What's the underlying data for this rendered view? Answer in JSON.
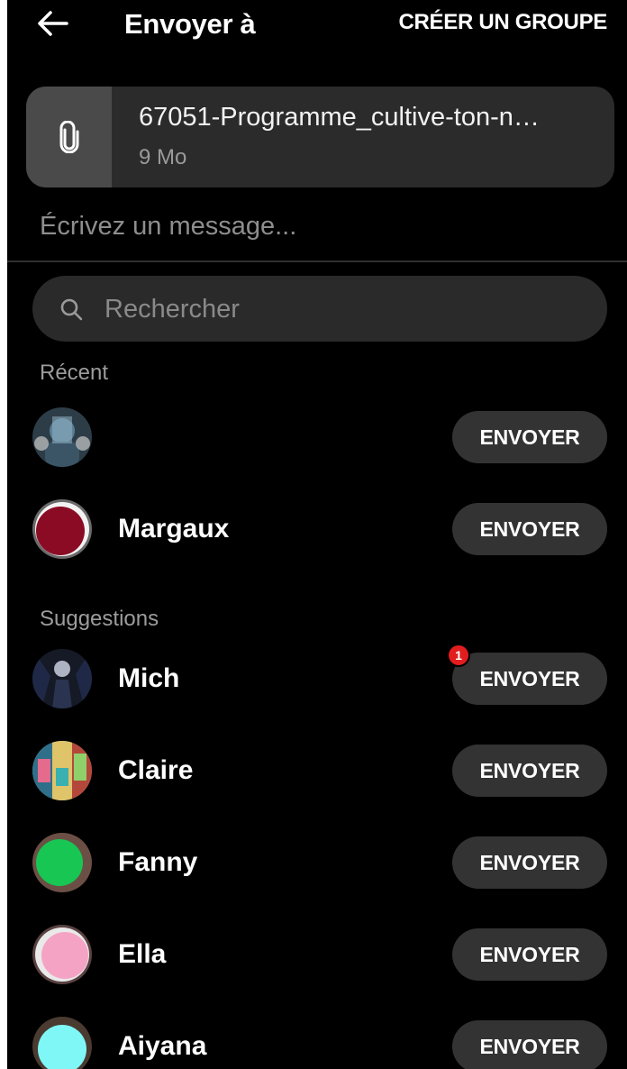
{
  "header": {
    "title": "Envoyer à",
    "create_group_label": "CRÉER UN GROUPE",
    "back_icon": "arrow-left-icon"
  },
  "attachment": {
    "icon": "paperclip-icon",
    "file_name": "67051-Programme_cultive-ton-n…",
    "file_size": "9 Mo"
  },
  "message": {
    "placeholder": "Écrivez un message..."
  },
  "search": {
    "icon": "search-icon",
    "placeholder": "Rechercher"
  },
  "sections": {
    "recent_label": "Récent",
    "suggestions_label": "Suggestions"
  },
  "send_label": "ENVOYER",
  "recent": [
    {
      "name": "",
      "avatar_color": "#3b5566"
    },
    {
      "name": "Margaux",
      "avatar_color": "#8b0b24"
    }
  ],
  "suggestions": [
    {
      "name": "Mich",
      "avatar_color": "#1c2233",
      "badge": "1"
    },
    {
      "name": "Claire",
      "avatar_color": "#3a8a8a"
    },
    {
      "name": "Fanny",
      "avatar_color": "#17c653"
    },
    {
      "name": "Ella",
      "avatar_color": "#f5a3c4"
    },
    {
      "name": "Aiyana",
      "avatar_color": "#7ff7f7"
    }
  ]
}
